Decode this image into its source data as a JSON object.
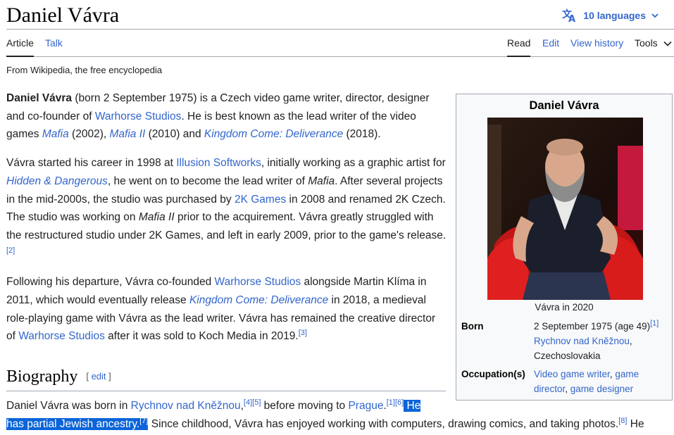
{
  "header": {
    "title": "Daniel Vávra",
    "languages_label": "10 languages"
  },
  "tabs": {
    "article": "Article",
    "talk": "Talk",
    "read": "Read",
    "edit": "Edit",
    "view_history": "View history",
    "tools": "Tools"
  },
  "tagline": "From Wikipedia, the free encyclopedia",
  "intro": {
    "p1": {
      "name": "Daniel Vávra",
      "t1": " (born 2 September 1975) is a Czech video game writer, director, designer and co-founder of ",
      "link_warhorse": "Warhorse Studios",
      "t2": ". He is best known as the lead writer of the video games ",
      "link_mafia": "Mafia",
      "t3": " (2002), ",
      "link_mafia2": "Mafia II",
      "t4": " (2010) and ",
      "link_kcd": "Kingdom Come: Deliverance",
      "t5": " (2018)."
    },
    "p2": {
      "t1": "Vávra started his career in 1998 at ",
      "link_illusion": "Illusion Softworks",
      "t2": ", initially working as a graphic artist for ",
      "link_hd": "Hidden & Dangerous",
      "t3": ", he went on to become the lead writer of ",
      "mafia": "Mafia",
      "t4": ". After several projects in the mid-2000s, the studio was purchased by ",
      "link_2k": "2K Games",
      "t5": " in 2008 and renamed 2K Czech. The studio was working on ",
      "mafia2": "Mafia II",
      "t6": " prior to the acquirement. Vávra greatly struggled with the restructured studio under 2K Games, and left in early 2009, prior to the game's release.",
      "ref": "[2]"
    },
    "p3": {
      "t1": "Following his departure, Vávra co-founded ",
      "link_warhorse": "Warhorse Studios",
      "t2": " alongside Martin Klíma in 2011, which would eventually release ",
      "link_kcd": "Kingdom Come: Deliverance",
      "t3": " in 2018, a medieval role-playing game with Vávra as the lead writer. Vávra has remained the creative director of ",
      "link_warhorse2": "Warhorse Studios",
      "t4": " after it was sold to Koch Media in 2019.",
      "ref": "[3]"
    }
  },
  "biography": {
    "heading": "Biography",
    "edit_label": "edit",
    "open_bracket": "[ ",
    "close_bracket": " ]",
    "t1": "Daniel Vávra was born in ",
    "link_rychnov": "Rychnov nad Kněžnou",
    "ref4": "[4]",
    "ref5": "[5]",
    "t2": " before moving to ",
    "link_prague": "Prague",
    "ref1": "[1]",
    "ref6": "[6]",
    "sel1": " He",
    "sel2": "has partial Jewish ancestry.",
    "ref7": "[7]",
    "t3": " Since childhood, Vávra has enjoyed working with computers, drawing comics, and taking photos.",
    "ref8": "[8]",
    "t4": " He"
  },
  "infobox": {
    "title": "Daniel Vávra",
    "caption": "Vávra in 2020",
    "born_label": "Born",
    "born_date": "2 September 1975 (age 49)",
    "born_ref": "[1]",
    "born_place_link": "Rychnov nad Kněžnou",
    "born_country": "Czechoslovakia",
    "occupation_label": "Occupation(s)",
    "occ1": "Video game writer",
    "occ2": "game director",
    "occ3": "game designer"
  },
  "colors": {
    "link": "#3366cc",
    "selection": "#0b64d8",
    "infobox_bg": "#f8f9fa",
    "border": "#a2a9b1"
  }
}
